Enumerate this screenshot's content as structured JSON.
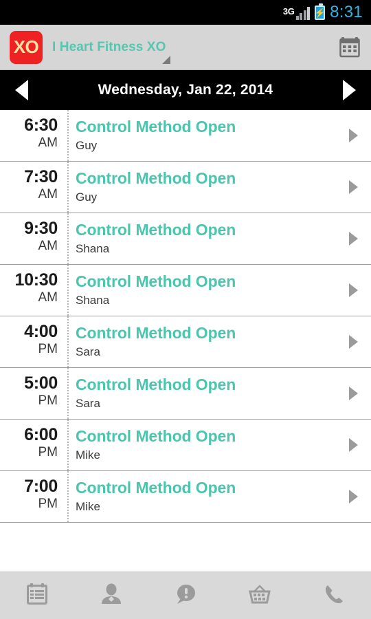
{
  "status_bar": {
    "network": "3G",
    "time": "8:31",
    "battery_icon": "battery-charging-icon",
    "signal_icon": "signal-bars-icon",
    "time_color": "#33b5e5"
  },
  "action_bar": {
    "logo_text": "XO",
    "logo_color": "#ee2222",
    "logo_text_color": "#f7dfa6",
    "title": "I Heart Fitness XO",
    "title_color": "#57c5b0",
    "spinner_icon": "dropdown-caret-icon",
    "calendar_icon": "calendar-icon",
    "background": "#d6d6d6"
  },
  "date_nav": {
    "prev_icon": "previous-day-arrow-icon",
    "next_icon": "next-day-arrow-icon",
    "date": "Wednesday, Jan 22, 2014",
    "background": "#000000"
  },
  "schedule": {
    "accent_color": "#4dc4ae",
    "classes": [
      {
        "time": "6:30",
        "meridiem": "AM",
        "title": "Control Method Open",
        "instructor": "Guy"
      },
      {
        "time": "7:30",
        "meridiem": "AM",
        "title": "Control Method Open",
        "instructor": "Guy"
      },
      {
        "time": "9:30",
        "meridiem": "AM",
        "title": "Control Method Open",
        "instructor": "Shana"
      },
      {
        "time": "10:30",
        "meridiem": "AM",
        "title": "Control Method Open",
        "instructor": "Shana"
      },
      {
        "time": "4:00",
        "meridiem": "PM",
        "title": "Control Method Open",
        "instructor": "Sara"
      },
      {
        "time": "5:00",
        "meridiem": "PM",
        "title": "Control Method Open",
        "instructor": "Sara"
      },
      {
        "time": "6:00",
        "meridiem": "PM",
        "title": "Control Method Open",
        "instructor": "Mike"
      },
      {
        "time": "7:00",
        "meridiem": "PM",
        "title": "Control Method Open",
        "instructor": "Mike"
      }
    ]
  },
  "tab_bar": {
    "background": "#d9d9d9",
    "icon_color": "#9b9b9b",
    "tabs": [
      {
        "icon": "schedule-calendar-icon"
      },
      {
        "icon": "profile-person-icon"
      },
      {
        "icon": "alerts-speech-bubble-icon"
      },
      {
        "icon": "shop-basket-icon"
      },
      {
        "icon": "phone-call-icon"
      }
    ]
  }
}
